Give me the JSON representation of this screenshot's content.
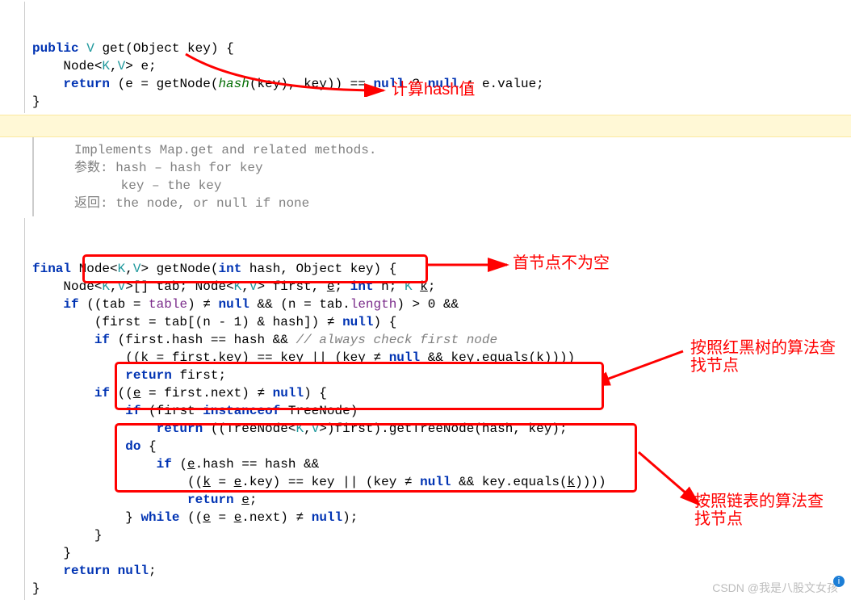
{
  "block1": {
    "l1a": "public",
    "l1b": "V",
    "l1c": "get(Object key) {",
    "l2a": "Node<",
    "l2b": "K",
    "l2c": ",",
    "l2d": "V",
    "l2e": "> e;",
    "l3a": "return",
    "l3b": "(e = getNode(",
    "l3c": "hash",
    "l3d": "(key), key)) ==",
    "l3e": "null",
    "l3f": "?",
    "l3g": "null",
    "l3h": ": e.value;",
    "l4": "}"
  },
  "doc": {
    "l1": "Implements Map.get and related methods.",
    "l2": "参数: hash – hash for key",
    "l3": "      key – the key",
    "l4": "返回: the node, or null if none"
  },
  "block2": {
    "l1a": "final",
    "l1b": "Node<",
    "l1c": "K",
    "l1d": ",",
    "l1e": "V",
    "l1f": "> getNode(",
    "l1g": "int",
    "l1h": "hash, Object key) {",
    "l2a": "Node<",
    "l2b": "K",
    "l2c": ",",
    "l2d": "V",
    "l2e": ">[] tab; Node<",
    "l2f": "K",
    "l2g": ",",
    "l2h": "V",
    "l2i": "> first, ",
    "l2u": "e",
    "l2j": ";",
    "l2k": "int",
    "l2l": "n;",
    "l2m": "K",
    "l2n": "k",
    "l2o": ";",
    "l3a": "if",
    "l3b": "((tab =",
    "l3c": "table",
    "l3d": ") ≠",
    "l3e": "null",
    "l3f": "&& (n = tab.",
    "l3g": "length",
    "l3h": ") > 0 &&",
    "l4a": "(first = tab[(n - 1) & hash]) ≠",
    "l4b": "null",
    "l4c": ") {",
    "l5a": "if",
    "l5b": "(first.hash == hash &&",
    "l5c": "// always check first node",
    "l6a": "((",
    "l6u": "k",
    "l6b": " = first.key) == key || (key ≠",
    "l6c": "null",
    "l6d": "&& key.equals(",
    "l6u2": "k",
    "l6e": "))))",
    "l7a": "return",
    "l7b": "first;",
    "l8a": "if",
    "l8b": "((",
    "l8u": "e",
    "l8c": " = first.next) ≠",
    "l8d": "null",
    "l8e": ") {",
    "l9a": "if",
    "l9b": "(first",
    "l9c": "instanceof",
    "l9d": "TreeNode)",
    "l10a": "return",
    "l10b": "((TreeNode<",
    "l10c": "K",
    "l10d": ",",
    "l10e": "V",
    "l10f": ">)first).getTreeNode(hash, key);",
    "l11a": "do",
    "l11b": "{",
    "l12a": "if",
    "l12b": "(",
    "l12u": "e",
    "l12c": ".hash == hash &&",
    "l13a": "((",
    "l13u": "k",
    "l13b": " = ",
    "l13u2": "e",
    "l13c": ".key) == key || (key ≠",
    "l13d": "null",
    "l13e": "&& key.equals(",
    "l13u3": "k",
    "l13f": "))))",
    "l14a": "return",
    "l14u": "e",
    "l14b": ";",
    "l15a": "}",
    "l15b": "while",
    "l15c": "((",
    "l15u": "e",
    "l15d": " = ",
    "l15u2": "e",
    "l15e": ".next) ≠",
    "l15f": "null",
    "l15g": ");",
    "l16": "}",
    "l17": "}",
    "l18a": "return null",
    "l18b": ";",
    "l19": "}"
  },
  "annotations": {
    "a1": "计算hash值",
    "a2": "首节点不为空",
    "a3": "按照红黑树的算法查找节点",
    "a4": "按照链表的算法查找节点"
  },
  "watermark": "CSDN @我是八股文女孩",
  "info": "i"
}
